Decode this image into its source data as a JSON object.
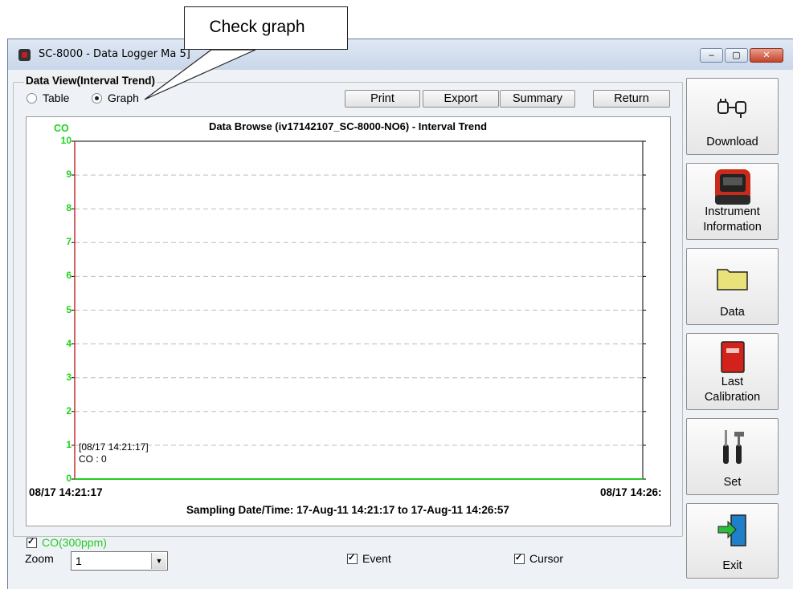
{
  "window": {
    "title": "SC-8000 - Data Logger Ma",
    "title_suffix": "5]",
    "controls": {
      "minimize": "‒",
      "maximize": "▢",
      "close": "✕"
    }
  },
  "callout": {
    "text": "Check graph"
  },
  "data_view": {
    "group_label": "Data View(Interval Trend)",
    "mode_options": [
      {
        "label": "Table",
        "selected": false
      },
      {
        "label": "Graph",
        "selected": true
      }
    ]
  },
  "toolbar": {
    "print": "Print",
    "export": "Export",
    "summary": "Summary",
    "return": "Return"
  },
  "chart_data": {
    "type": "line",
    "title": "Data Browse (iv17142107_SC-8000-NO6) - Interval Trend",
    "ylabel": "CO",
    "ylim": [
      0,
      10
    ],
    "yticks": [
      "0",
      "1",
      "2",
      "3",
      "4",
      "5",
      "6",
      "7",
      "8",
      "9",
      "10"
    ],
    "x_start_label": "08/17 14:21:17",
    "x_end_label": "08/17 14:26:",
    "xlabel": "Sampling Date/Time: 17-Aug-11 14:21:17 to 17-Aug-11 14:26:57",
    "series": [
      {
        "name": "CO(300ppm)",
        "color": "#22cc22",
        "values": [
          0,
          0
        ]
      }
    ],
    "cursor_readout": {
      "time": "[08/17 14:21:17]",
      "value": "CO : 0"
    },
    "grid": "dashed horizontal"
  },
  "bottom": {
    "series_toggle": "CO(300ppm)",
    "zoom_label": "Zoom",
    "zoom_value": "1",
    "event_label": "Event",
    "cursor_label": "Cursor"
  },
  "sidebar": {
    "download": "Download",
    "instrument_info": [
      "Instrument",
      "Information"
    ],
    "data": "Data",
    "last_calibration": [
      "Last",
      "Calibration"
    ],
    "set": "Set",
    "exit": "Exit"
  },
  "colors": {
    "series": "#22cc22",
    "axis_red": "#c03030",
    "grid": "#bcbcbc"
  }
}
